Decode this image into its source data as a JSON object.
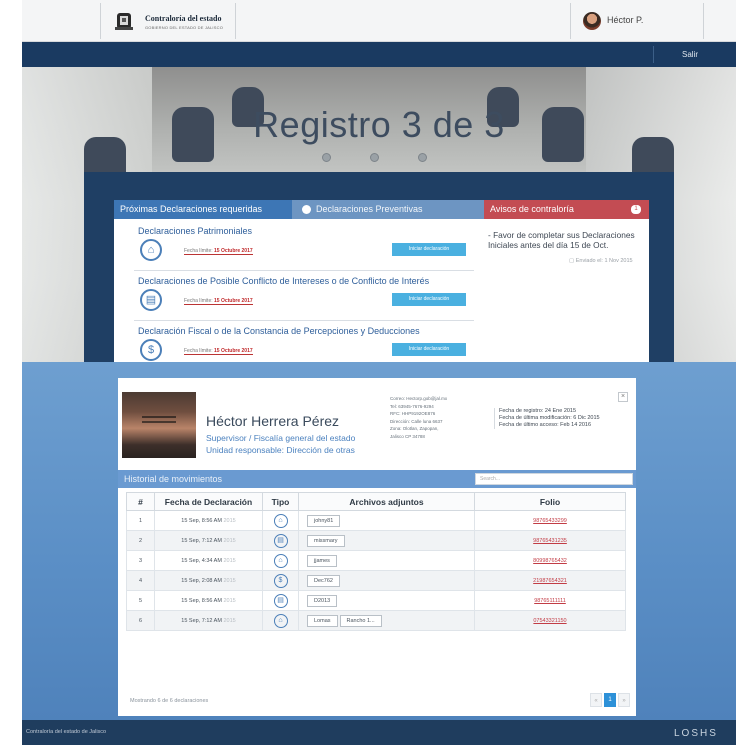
{
  "header": {
    "org_title": "Contraloría del estado",
    "org_subtitle": "GOBIERNO DEL ESTADO DE JALISCO",
    "user_name": "Héctor P.",
    "logout": "Salir"
  },
  "hero": {
    "title": "Registro 3 de 3",
    "step_dots": 3
  },
  "declarations": {
    "tabs": [
      "Próximas Declaraciones requeridas",
      "Declaraciones Preventivas"
    ],
    "items": [
      {
        "title": "Declaraciones Patrimoniales",
        "limit_label": "Fecha límite:",
        "limit_date": "15 Octubre 2017",
        "button": "Iniciar declaración",
        "icon": "house-icon"
      },
      {
        "title": "Declaraciones de Posible Conflicto de Intereses o de Conflicto de Interés",
        "limit_label": "Fecha límite:",
        "limit_date": "15 Octubre 2017",
        "button": "Iniciar declaración",
        "icon": "document-icon"
      },
      {
        "title": "Declaración Fiscal o de la Constancia de Percepciones y Deducciones",
        "limit_label": "Fecha límite:",
        "limit_date": "15 Octubre 2017",
        "button": "Iniciar declaración",
        "icon": "receipt-icon"
      }
    ]
  },
  "notices": {
    "title": "Avisos de contraloría",
    "badge": "1",
    "message": "- Favor de completar sus Declaraciones Iniciales antes del día 15 de Oct.",
    "sent": "Enviado el: 1 Nov 2015"
  },
  "profile": {
    "name": "Héctor Herrera Pérez",
    "role": "Supervisor / Fiscalía general del estado",
    "unit": "Unidad responsable: Dirección de otras",
    "contact": [
      "Correo: Hectorp.gob@jal.mx",
      "Tel: 63945-7676-9294",
      "RFC: HHP9192OE876",
      "Dirección: Calle luna 6637",
      "Zona: Olotlan, Zapopan,",
      "Jalisco CP 34788"
    ],
    "dates": [
      "Fecha de registro: 24 Ene 2015",
      "Fecha de última modificación: 6 Dic 2015",
      "Fecha de último acceso: Feb 14 2016"
    ],
    "close": "×"
  },
  "history": {
    "title": "Historial de movimientos",
    "search_placeholder": "Search...",
    "columns": [
      "#",
      "Fecha de Declaración",
      "Tipo",
      "Archivos adjuntos",
      "Folio"
    ],
    "rows": [
      {
        "n": "1",
        "date": "15 Sep, 8:56 AM",
        "year": "2015",
        "icon": "house-icon",
        "files": [
          "johny81"
        ],
        "folio": "98765433299"
      },
      {
        "n": "2",
        "date": "15 Sep, 7:12 AM",
        "year": "2015",
        "icon": "document-icon",
        "files": [
          "missmary"
        ],
        "folio": "98765431235"
      },
      {
        "n": "3",
        "date": "15 Sep, 4:34 AM",
        "year": "2015",
        "icon": "house-icon",
        "files": [
          "jjames"
        ],
        "folio": "80998765432"
      },
      {
        "n": "4",
        "date": "15 Sep, 2:08 AM",
        "year": "2015",
        "icon": "receipt-icon",
        "files": [
          "Dec762"
        ],
        "folio": "21987654321"
      },
      {
        "n": "5",
        "date": "15 Sep, 8:56 AM",
        "year": "2015",
        "icon": "document-icon",
        "files": [
          "D2013"
        ],
        "folio": "98765111111"
      },
      {
        "n": "6",
        "date": "15 Sep, 7:12 AM",
        "year": "2015",
        "icon": "house-icon",
        "files": [
          "Lomas",
          "Rancho 1..."
        ],
        "folio": "07543321150"
      }
    ],
    "showing": "Mostrando 6 de 6 declaraciones",
    "pagination": {
      "prev": "«",
      "current": "1",
      "next": "»"
    }
  },
  "footer": {
    "text": "Contraloría del estado de Jalisco",
    "brand": "LOSHS"
  }
}
